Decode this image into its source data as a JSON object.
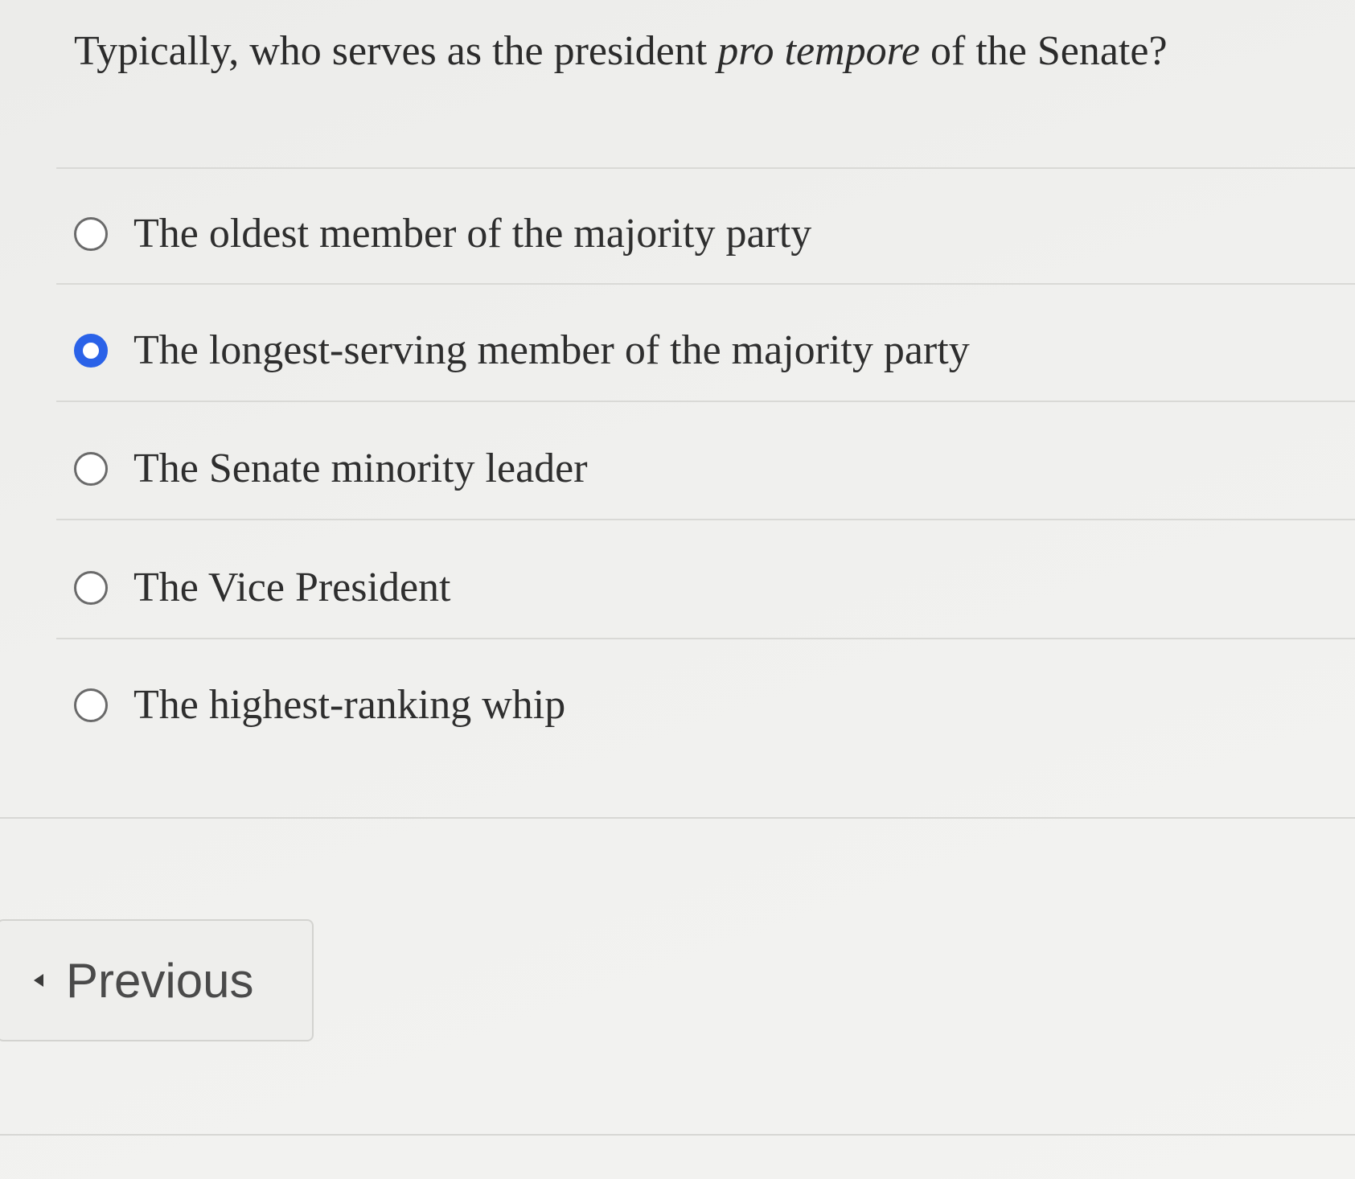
{
  "question": {
    "text_before": "Typically, who serves as the president ",
    "text_italic": "pro tempore",
    "text_after": " of the Senate?"
  },
  "options": [
    {
      "label": "The oldest member of the majority party",
      "selected": false
    },
    {
      "label": "The longest-serving member of the majority party",
      "selected": true
    },
    {
      "label": "The Senate minority leader",
      "selected": false
    },
    {
      "label": "The Vice President",
      "selected": false
    },
    {
      "label": "The highest-ranking whip",
      "selected": false
    }
  ],
  "navigation": {
    "previous_label": "Previous"
  },
  "colors": {
    "selected_radio": "#2a62e8"
  }
}
